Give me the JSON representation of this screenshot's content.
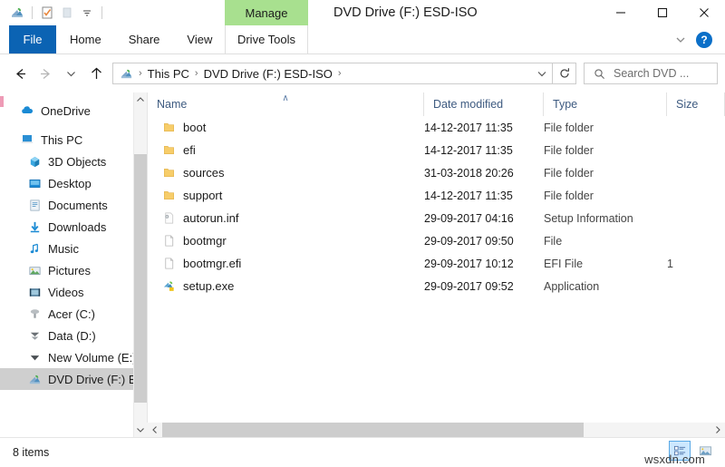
{
  "window": {
    "title": "DVD Drive (F:) ESD-ISO",
    "contextual_tab_group": "Manage",
    "contextual_tab": "Drive Tools",
    "minimize_label": "Minimize",
    "maximize_label": "Maximize",
    "close_label": "Close",
    "help_label": "?",
    "ribbon_collapse_label": "Minimize the Ribbon",
    "accent_color": "#0b63b3",
    "contextual_color": "#a8e08f"
  },
  "quick_access_toolbar": {
    "items": [
      {
        "name": "dvd-drive-icon",
        "label": "DVD Drive"
      },
      {
        "name": "properties-icon",
        "label": "Properties"
      },
      {
        "name": "new-folder-icon",
        "label": "New folder"
      },
      {
        "name": "customize-dropdown-icon",
        "label": "Customize Quick Access Toolbar"
      }
    ]
  },
  "ribbon": {
    "tabs": [
      {
        "label": "File",
        "active": true
      },
      {
        "label": "Home",
        "active": false
      },
      {
        "label": "Share",
        "active": false
      },
      {
        "label": "View",
        "active": false
      }
    ]
  },
  "navigation": {
    "back_label": "Back",
    "forward_label": "Forward",
    "recent_label": "Recent locations",
    "up_label": "Up",
    "refresh_label": "Refresh"
  },
  "breadcrumb": {
    "icon": "dvd-drive-icon",
    "segments": [
      "This PC",
      "DVD Drive (F:) ESD-ISO"
    ],
    "separator": "›"
  },
  "search": {
    "placeholder": "Search DVD ...",
    "icon": "search-icon"
  },
  "sidebar": {
    "items": [
      {
        "label": "OneDrive",
        "icon": "onedrive-cloud-icon",
        "indent": false,
        "selected": false
      },
      {
        "label": "This PC",
        "icon": "this-pc-icon",
        "indent": false,
        "selected": false
      },
      {
        "label": "3D Objects",
        "icon": "3d-objects-icon",
        "indent": true,
        "selected": false
      },
      {
        "label": "Desktop",
        "icon": "desktop-icon",
        "indent": true,
        "selected": false
      },
      {
        "label": "Documents",
        "icon": "documents-icon",
        "indent": true,
        "selected": false
      },
      {
        "label": "Downloads",
        "icon": "downloads-icon",
        "indent": true,
        "selected": false
      },
      {
        "label": "Music",
        "icon": "music-note-icon",
        "indent": true,
        "selected": false
      },
      {
        "label": "Pictures",
        "icon": "pictures-icon",
        "indent": true,
        "selected": false
      },
      {
        "label": "Videos",
        "icon": "videos-icon",
        "indent": true,
        "selected": false
      },
      {
        "label": "Acer (C:)",
        "icon": "hard-drive-icon",
        "indent": true,
        "selected": false
      },
      {
        "label": "Data (D:)",
        "icon": "hard-drive-icon",
        "indent": true,
        "selected": false
      },
      {
        "label": "New Volume (E:)",
        "icon": "hard-drive-icon",
        "indent": true,
        "selected": false
      },
      {
        "label": "DVD Drive (F:) ES",
        "icon": "dvd-drive-icon",
        "indent": true,
        "selected": true
      }
    ]
  },
  "columns": [
    {
      "label": "Name",
      "sorted": "asc",
      "sort_glyph": "∧"
    },
    {
      "label": "Date modified",
      "sorted": null,
      "sort_glyph": ""
    },
    {
      "label": "Type",
      "sorted": null,
      "sort_glyph": ""
    },
    {
      "label": "Size",
      "sorted": null,
      "sort_glyph": ""
    }
  ],
  "files": [
    {
      "name": "boot",
      "icon": "folder-icon",
      "date": "14-12-2017 11:35",
      "type": "File folder",
      "size": ""
    },
    {
      "name": "efi",
      "icon": "folder-icon",
      "date": "14-12-2017 11:35",
      "type": "File folder",
      "size": ""
    },
    {
      "name": "sources",
      "icon": "folder-icon",
      "date": "31-03-2018 20:26",
      "type": "File folder",
      "size": ""
    },
    {
      "name": "support",
      "icon": "folder-icon",
      "date": "14-12-2017 11:35",
      "type": "File folder",
      "size": ""
    },
    {
      "name": "autorun.inf",
      "icon": "setup-information-icon",
      "date": "29-09-2017 04:16",
      "type": "Setup Information",
      "size": ""
    },
    {
      "name": "bootmgr",
      "icon": "generic-file-icon",
      "date": "29-09-2017 09:50",
      "type": "File",
      "size": ""
    },
    {
      "name": "bootmgr.efi",
      "icon": "generic-file-icon",
      "date": "29-09-2017 10:12",
      "type": "EFI File",
      "size": "1"
    },
    {
      "name": "setup.exe",
      "icon": "application-icon",
      "date": "29-09-2017 09:52",
      "type": "Application",
      "size": ""
    }
  ],
  "statusbar": {
    "item_count": "8 items",
    "details_view_label": "Details view",
    "large_icons_view_label": "Large icons view"
  },
  "watermark": "wsxdn.com"
}
